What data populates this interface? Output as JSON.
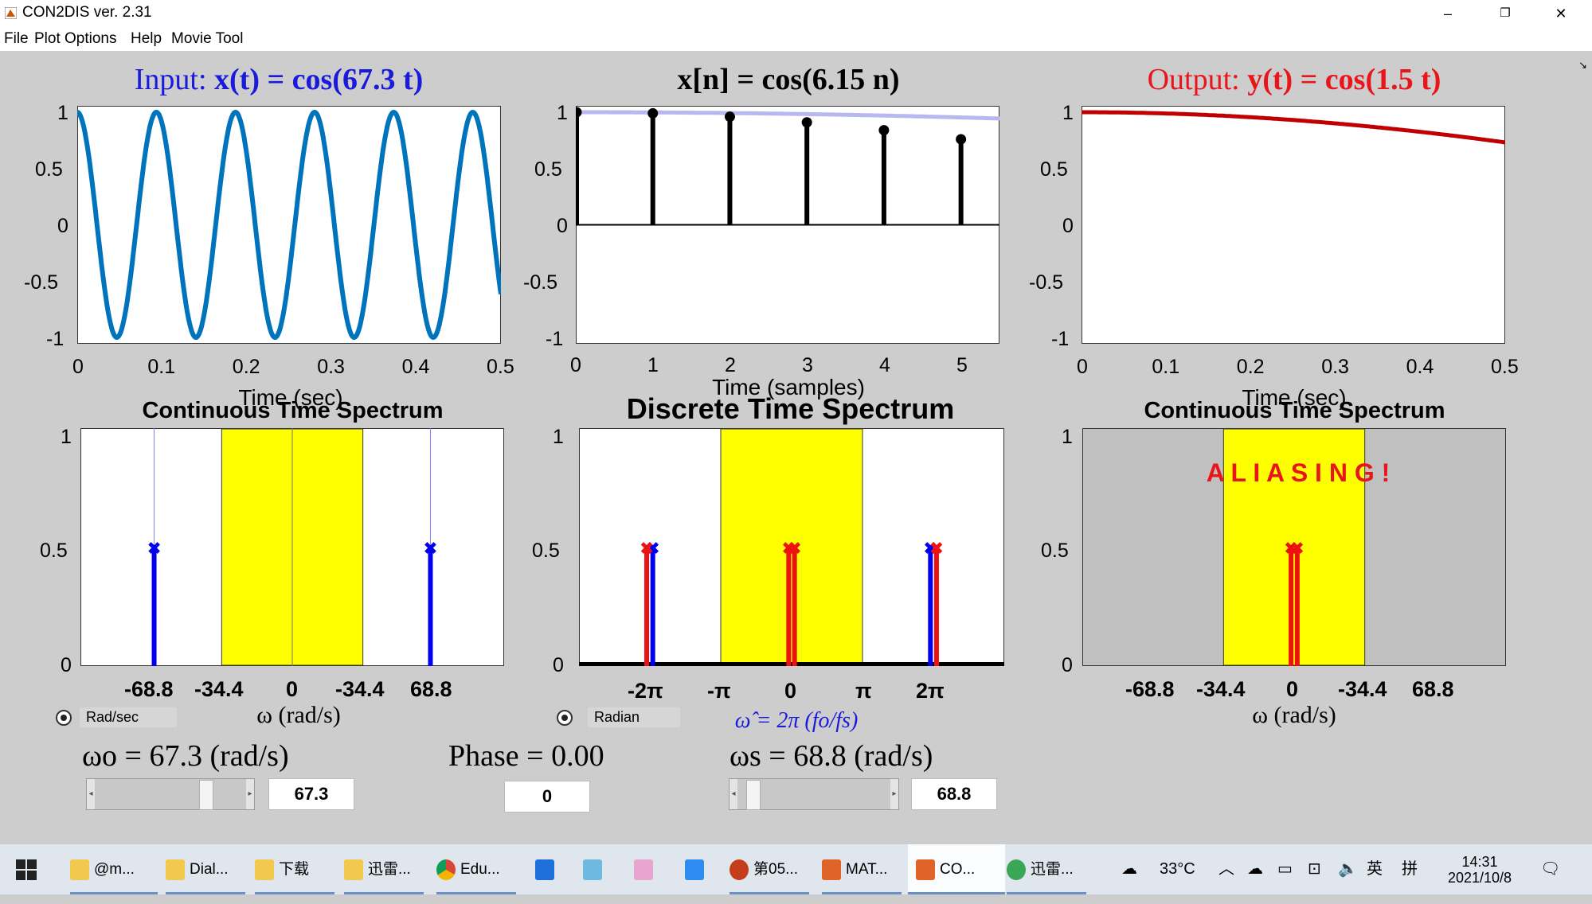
{
  "window": {
    "title": "CON2DIS ver. 2.31",
    "menu": [
      "File",
      "Plot Options",
      "Help",
      "Movie Tool"
    ]
  },
  "colors": {
    "input": "#1a1adb",
    "output": "#e8161b",
    "signal_blue": "#0073bd",
    "output_red": "#c00000",
    "passband": "#ffff00",
    "stopband_gray": "#c0c0c0"
  },
  "plots": {
    "input": {
      "title_prefix": "Input:",
      "title_eq": "x(t) = cos(67.3 t)",
      "xlabel": "Time (sec)",
      "xticks": [
        "0",
        "0.1",
        "0.2",
        "0.3",
        "0.4",
        "0.5"
      ],
      "yticks": [
        "1",
        "0.5",
        "0",
        "-0.5",
        "-1"
      ]
    },
    "discrete": {
      "title_eq": "x[n] = cos(6.15 n)",
      "xlabel": "Time (samples)",
      "xticks": [
        "0",
        "1",
        "2",
        "3",
        "4",
        "5"
      ],
      "yticks": [
        "1",
        "0.5",
        "0",
        "-0.5",
        "-1"
      ]
    },
    "output": {
      "title_prefix": "Output:",
      "title_eq": "y(t) = cos(1.5 t)",
      "xlabel": "Time (sec)",
      "xticks": [
        "0",
        "0.1",
        "0.2",
        "0.3",
        "0.4",
        "0.5"
      ],
      "yticks": [
        "1",
        "0.5",
        "0",
        "-0.5",
        "-1"
      ]
    },
    "ct_spectrum_in": {
      "title": "Continuous Time Spectrum",
      "xticks": [
        "-68.8",
        "-34.4",
        "0",
        "-34.4",
        "68.8"
      ],
      "yticks": [
        "1",
        "0.5",
        "0"
      ],
      "xlabel": "ω (rad/s)"
    },
    "dt_spectrum": {
      "title": "Discrete Time Spectrum",
      "xticks": [
        "-2π",
        "-π",
        "0",
        "π",
        "2π"
      ],
      "yticks": [
        "1",
        "0.5",
        "0"
      ],
      "xlabel": "ω̂ = 2π (fo/fs)"
    },
    "ct_spectrum_out": {
      "title": "Continuous Time Spectrum",
      "xticks": [
        "-68.8",
        "-34.4",
        "0",
        "-34.4",
        "68.8"
      ],
      "yticks": [
        "1",
        "0.5",
        "0"
      ],
      "xlabel": "ω (rad/s)",
      "warning": "A L I A S I N G !"
    }
  },
  "chart_data": [
    {
      "type": "line",
      "title": "Input: x(t) = cos(67.3 t)",
      "xlabel": "Time (sec)",
      "xlim": [
        0,
        0.5
      ],
      "ylim": [
        -1,
        1
      ],
      "omega": 67.3,
      "function": "cos(67.3 t)"
    },
    {
      "type": "stem",
      "title": "x[n] = cos(6.15 n)",
      "xlabel": "Time (samples)",
      "xlim": [
        0,
        5.5
      ],
      "ylim": [
        -1,
        1
      ],
      "n": [
        0,
        1,
        2,
        3,
        4,
        5
      ],
      "values": [
        1.0,
        0.99,
        0.96,
        0.91,
        0.84,
        0.76
      ],
      "envelope": "cos(1.5 t)"
    },
    {
      "type": "line",
      "title": "Output: y(t) = cos(1.5 t)",
      "xlabel": "Time (sec)",
      "xlim": [
        0,
        0.5
      ],
      "ylim": [
        -1,
        1
      ],
      "omega": 1.5,
      "function": "cos(1.5 t)"
    },
    {
      "type": "stem",
      "title": "Continuous Time Spectrum",
      "xlabel": "ω (rad/s)",
      "ylim": [
        0,
        1
      ],
      "xlim": [
        -103.2,
        103.2
      ],
      "passband": [
        -34.4,
        34.4
      ],
      "lines": [
        {
          "x": -67.3,
          "y": 0.5,
          "color": "blue"
        },
        {
          "x": 67.3,
          "y": 0.5,
          "color": "blue"
        }
      ]
    },
    {
      "type": "stem",
      "title": "Discrete Time Spectrum",
      "xlabel": "ω̂ = 2π (fo/fs)",
      "ylim": [
        0,
        1
      ],
      "xlim": [
        -9.42,
        9.42
      ],
      "passband": [
        -3.14,
        3.14
      ],
      "lines": [
        {
          "x": -6.15,
          "y": 0.5,
          "color": "blue"
        },
        {
          "x": 6.15,
          "y": 0.5,
          "color": "blue"
        },
        {
          "x": -6.42,
          "y": 0.5,
          "color": "red"
        },
        {
          "x": -0.13,
          "y": 0.5,
          "color": "red"
        },
        {
          "x": 0.13,
          "y": 0.5,
          "color": "red"
        },
        {
          "x": 6.42,
          "y": 0.5,
          "color": "red"
        }
      ]
    },
    {
      "type": "stem",
      "title": "Continuous Time Spectrum",
      "xlabel": "ω (rad/s)",
      "ylim": [
        0,
        1
      ],
      "xlim": [
        -103.2,
        103.2
      ],
      "passband": [
        -34.4,
        34.4
      ],
      "lines": [
        {
          "x": -1.5,
          "y": 0.5,
          "color": "red"
        },
        {
          "x": 1.5,
          "y": 0.5,
          "color": "red"
        }
      ]
    }
  ],
  "controls": {
    "units_left": "Rad/sec",
    "units_mid": "Radian",
    "omega_o_label": "ωo = 67.3 (rad/s)",
    "omega_o_value": "67.3",
    "omega_o_slider": 0.75,
    "phase_label": "Phase = 0.00",
    "phase_value": "0",
    "omega_s_label": "ωs = 68.8 (rad/s)",
    "omega_s_value": "68.8",
    "omega_s_slider": 0.06
  },
  "taskbar": {
    "items": [
      "@m...",
      "Dial...",
      "下载",
      "迅雷...",
      "Edu...",
      "",
      "",
      "",
      "",
      "第05...",
      "MAT...",
      "CO...",
      "迅雷..."
    ],
    "weather": "33°C",
    "ime1": "英",
    "ime2": "拼",
    "time": "14:31",
    "date": "2021/10/8"
  }
}
